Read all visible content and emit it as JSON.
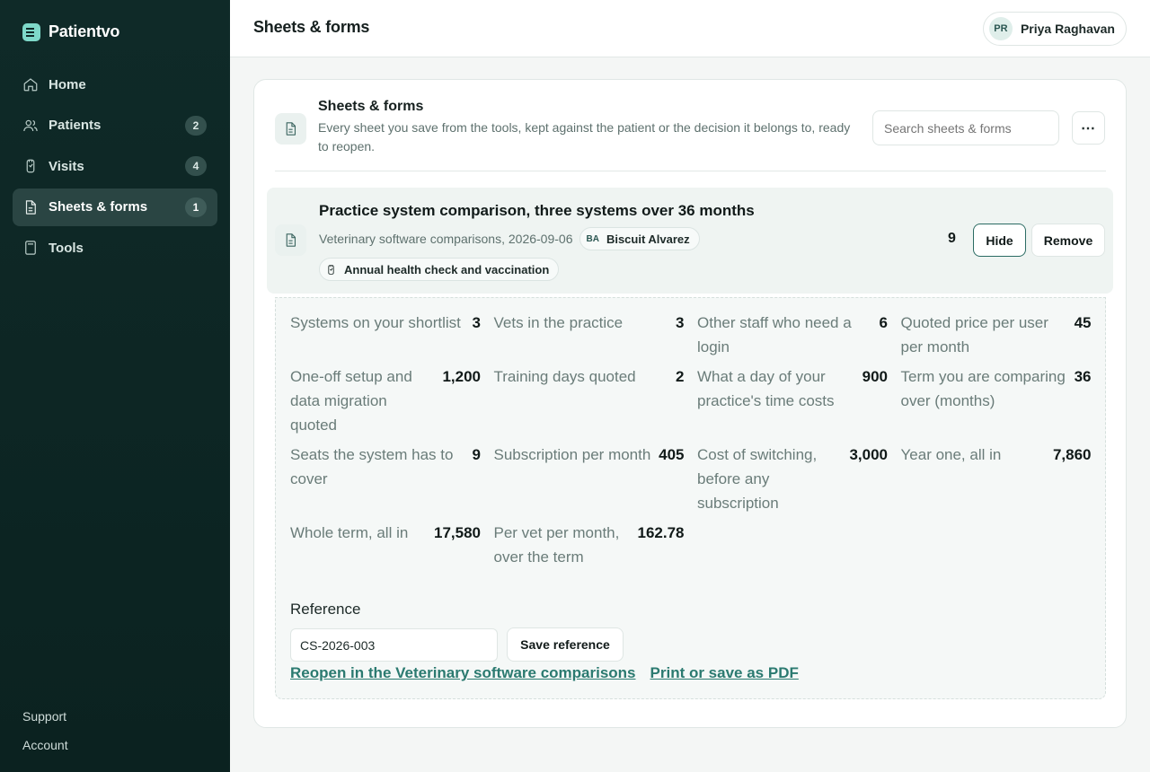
{
  "app": {
    "name": "Patientvo"
  },
  "sidebar": {
    "items": [
      {
        "label": "Home",
        "badge": null
      },
      {
        "label": "Patients",
        "badge": "2"
      },
      {
        "label": "Visits",
        "badge": "4"
      },
      {
        "label": "Sheets & forms",
        "badge": "1",
        "active": true
      },
      {
        "label": "Tools",
        "badge": null
      }
    ],
    "footer": {
      "support": "Support",
      "account": "Account"
    }
  },
  "header": {
    "title": "Sheets & forms",
    "user": {
      "initials": "PR",
      "name": "Priya Raghavan"
    }
  },
  "panel": {
    "title": "Sheets & forms",
    "description": "Every sheet you save from the tools, kept against the patient or the decision it belongs to, ready to reopen.",
    "search_placeholder": "Search sheets & forms",
    "more_label": "⋯"
  },
  "record": {
    "title": "Practice system comparison, three systems over 36 months",
    "source": "Veterinary software comparisons, 2026-09-06",
    "patient": {
      "initials": "BA",
      "name": "Biscuit Alvarez"
    },
    "visit": "Annual health check and vaccination",
    "count": "9",
    "hide_label": "Hide",
    "remove_label": "Remove",
    "fields": [
      {
        "label": "Systems on your shortlist",
        "value": "3"
      },
      {
        "label": "Vets in the practice",
        "value": "3"
      },
      {
        "label": "Other staff who need a login",
        "value": "6"
      },
      {
        "label": "Quoted price per user per month",
        "value": "45"
      },
      {
        "label": "One-off setup and data migration quoted",
        "value": "1,200"
      },
      {
        "label": "Training days quoted",
        "value": "2"
      },
      {
        "label": "What a day of your practice's time costs",
        "value": "900"
      },
      {
        "label": "Term you are comparing over (months)",
        "value": "36"
      },
      {
        "label": "Seats the system has to cover",
        "value": "9"
      },
      {
        "label": "Subscription per month",
        "value": "405"
      },
      {
        "label": "Cost of switching, before any subscription",
        "value": "3,000"
      },
      {
        "label": "Year one, all in",
        "value": "7,860"
      },
      {
        "label": "Whole term, all in",
        "value": "17,580"
      },
      {
        "label": "Per vet per month, over the term",
        "value": "162.78"
      }
    ],
    "reference": {
      "label": "Reference",
      "value": "CS-2026-003",
      "save_label": "Save reference"
    },
    "links": {
      "reopen": "Reopen in the Veterinary software comparisons",
      "print": "Print or save as PDF"
    }
  }
}
